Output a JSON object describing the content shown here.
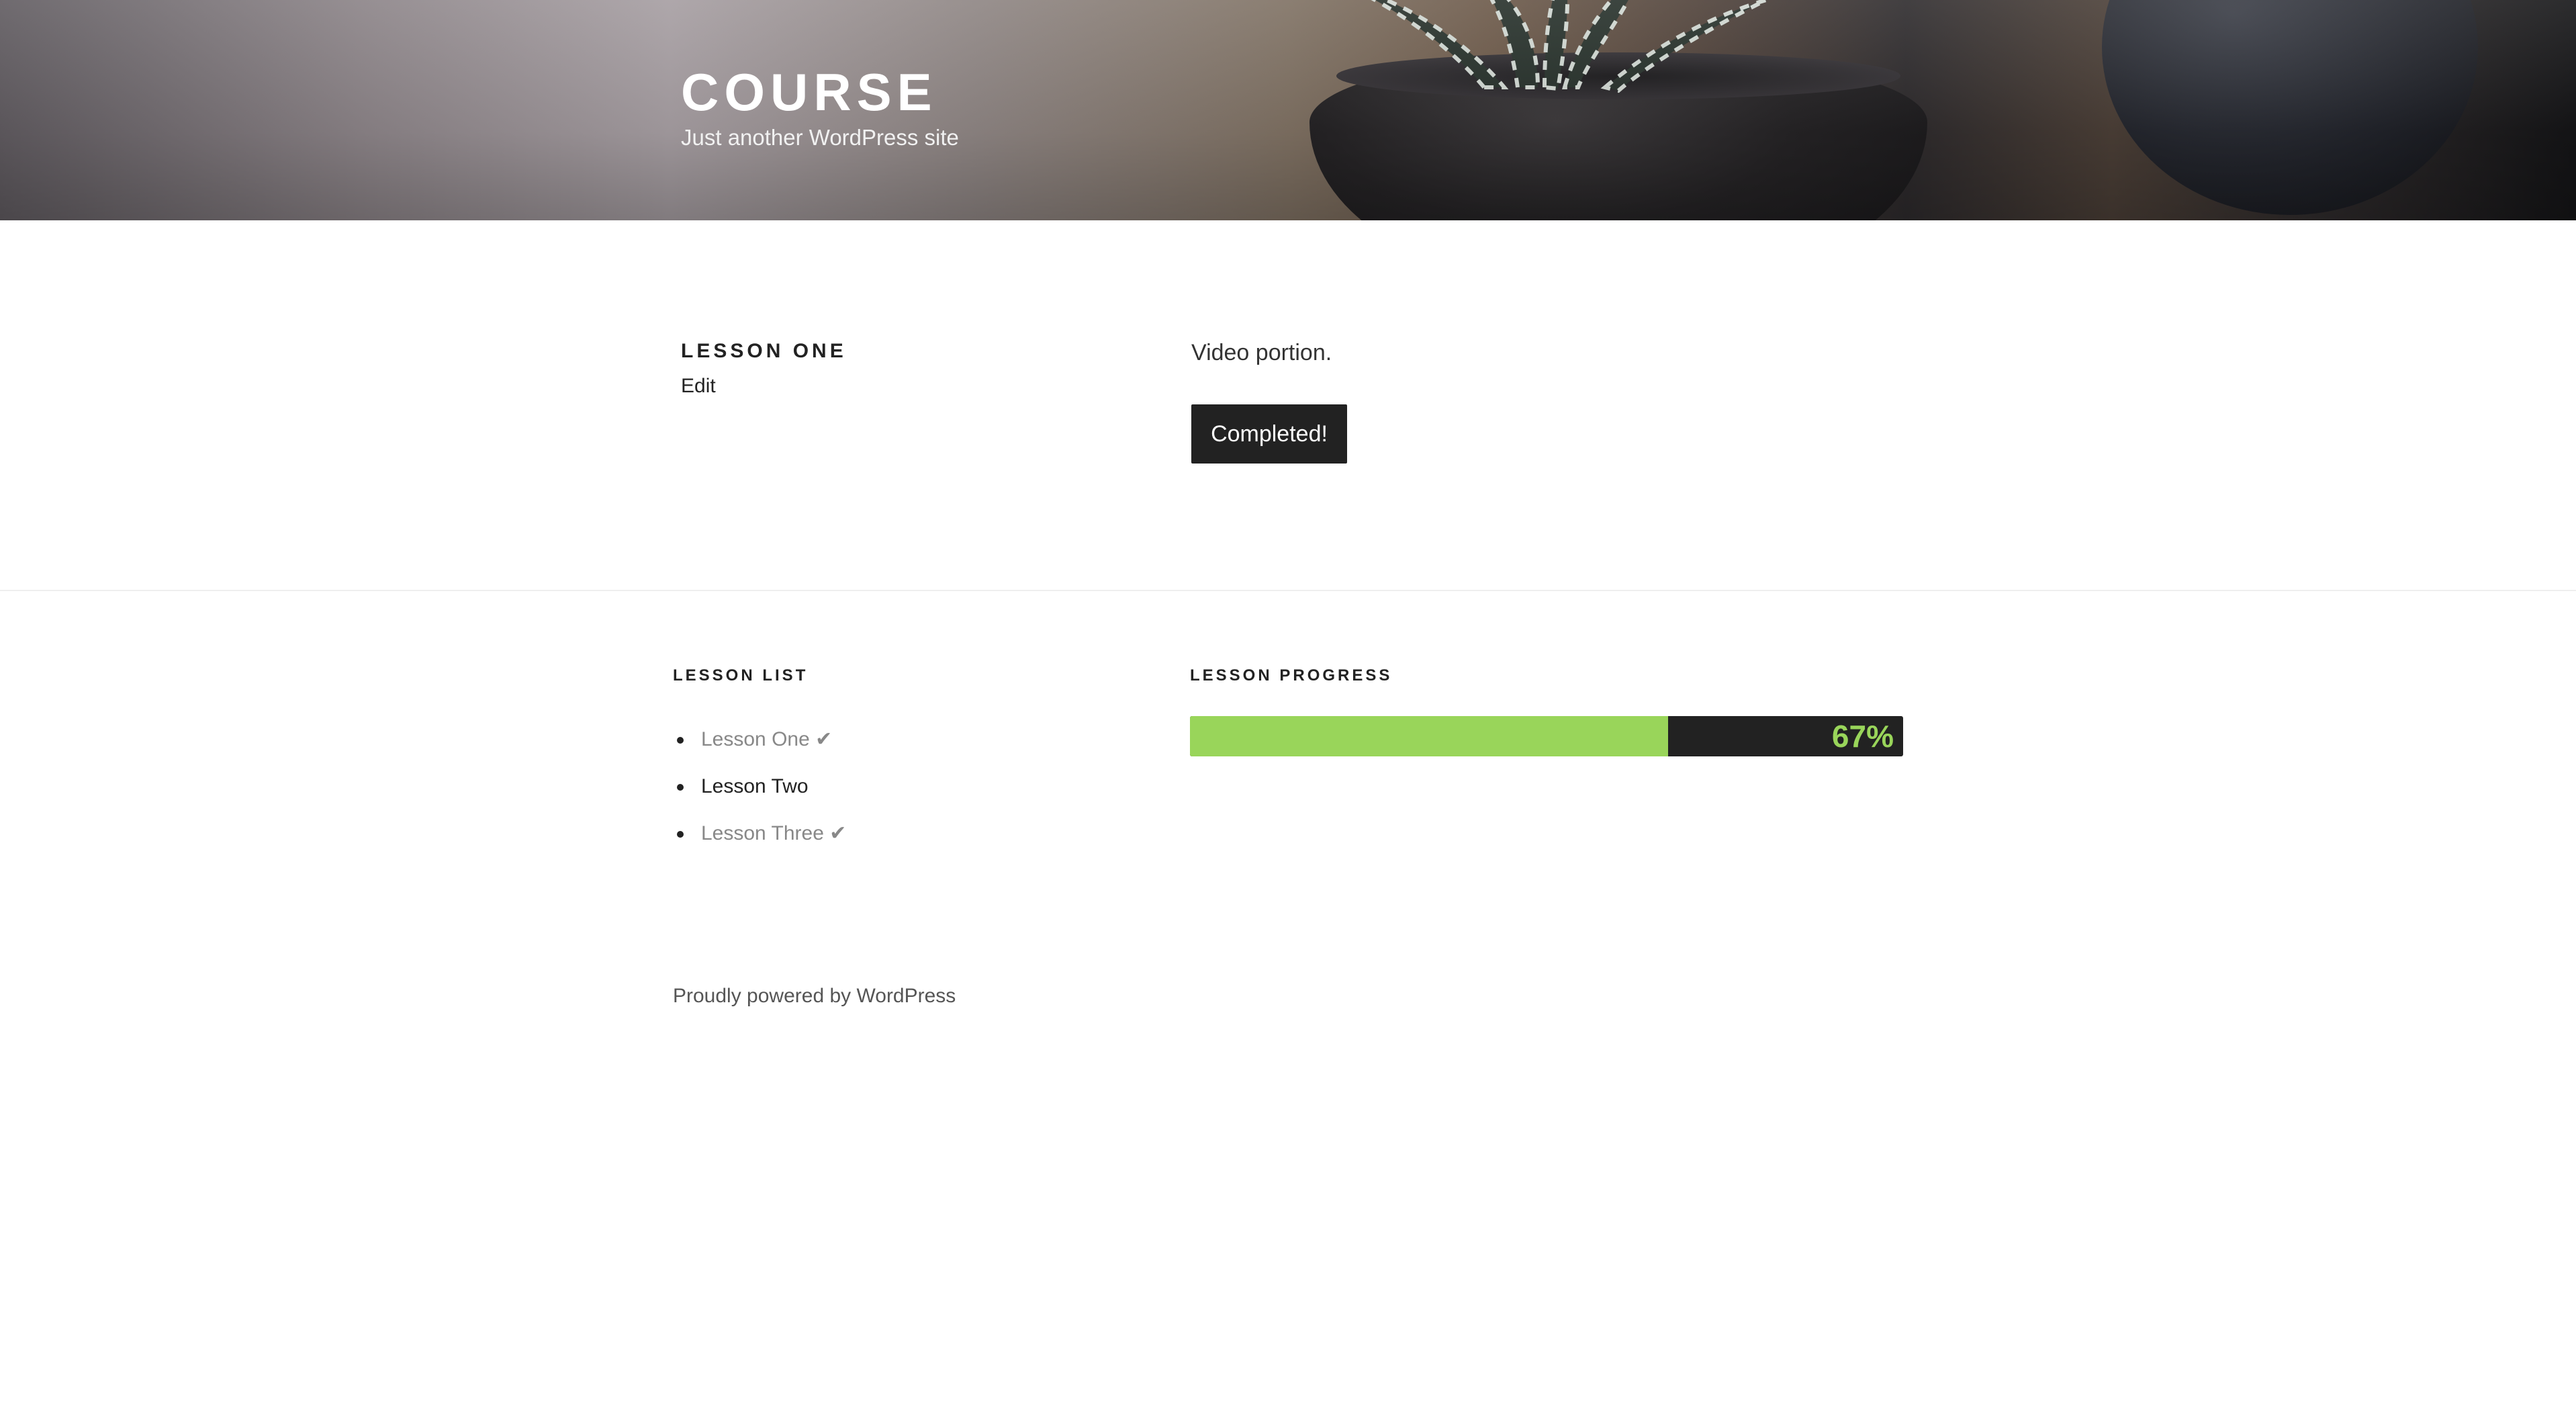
{
  "header": {
    "site_title": "COURSE",
    "site_description": "Just another WordPress site"
  },
  "entry": {
    "title": "LESSON ONE",
    "edit_label": "Edit",
    "content": "Video portion.",
    "complete_button_label": "Completed!"
  },
  "widgets": {
    "lesson_list": {
      "title": "LESSON LIST",
      "items": [
        {
          "label": "Lesson One ✔",
          "completed": true
        },
        {
          "label": "Lesson Two",
          "completed": false
        },
        {
          "label": "Lesson Three ✔",
          "completed": true
        }
      ]
    },
    "lesson_progress": {
      "title": "LESSON PROGRESS",
      "percent": 67,
      "percent_label": "67%",
      "fill_color": "#99d55a",
      "track_color": "#222222"
    }
  },
  "footer": {
    "powered_by": "Proudly powered by WordPress"
  },
  "colors": {
    "text_dark": "#222222",
    "text_muted": "#888888",
    "button_bg": "#222222",
    "button_text": "#ffffff"
  }
}
